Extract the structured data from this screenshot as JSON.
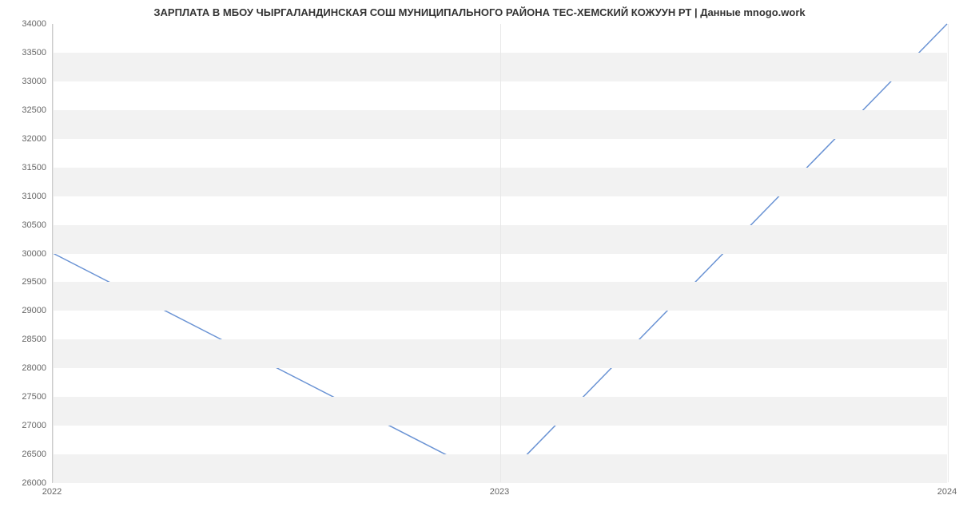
{
  "chart_data": {
    "type": "line",
    "title": "ЗАРПЛАТА В МБОУ ЧЫРГАЛАНДИНСКАЯ СОШ МУНИЦИПАЛЬНОГО РАЙОНА ТЕС-ХЕМСКИЙ КОЖУУН РТ | Данные mnogo.work",
    "x": [
      "2022",
      "2023",
      "2024"
    ],
    "values": [
      30000,
      26000,
      34000
    ],
    "xlabel": "",
    "ylabel": "",
    "ylim": [
      26000,
      34000
    ],
    "y_ticks": [
      26000,
      26500,
      27000,
      27500,
      28000,
      28500,
      29000,
      29500,
      30000,
      30500,
      31000,
      31500,
      32000,
      32500,
      33000,
      33500,
      34000
    ],
    "x_ticks": [
      "2022",
      "2023",
      "2024"
    ],
    "line_color": "#6a93d4"
  }
}
